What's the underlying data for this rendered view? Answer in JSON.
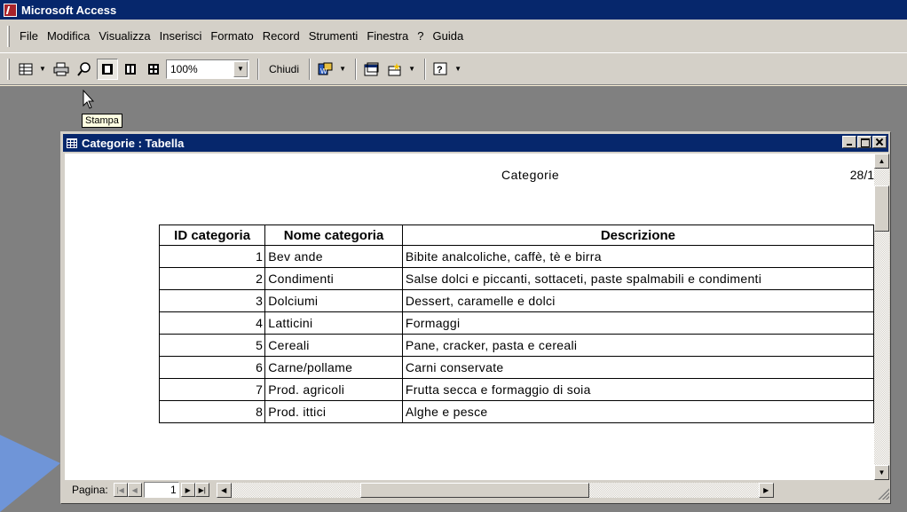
{
  "app": {
    "title": "Microsoft Access"
  },
  "menu": [
    "File",
    "Modifica",
    "Visualizza",
    "Inserisci",
    "Formato",
    "Record",
    "Strumenti",
    "Finestra",
    "?",
    "Guida"
  ],
  "toolbar": {
    "zoom_value": "100%",
    "close_label": "Chiudi",
    "tooltip": "Stampa",
    "icons": [
      "view-icon",
      "print-icon",
      "zoom-icon",
      "one-page-icon",
      "two-pages-icon",
      "multiple-pages-icon",
      "office-links-icon",
      "database-window-icon",
      "new-object-icon",
      "help-icon"
    ]
  },
  "document_window": {
    "title": "Categorie : Tabella",
    "report": {
      "header": "Categorie",
      "date": "28/1",
      "columns": [
        "ID categoria",
        "Nome categoria",
        "Descrizione"
      ],
      "rows": [
        [
          "1",
          "Bev ande",
          "Bibite analcoliche, caffè, tè e birra"
        ],
        [
          "2",
          "Condimenti",
          "Salse dolci e piccanti, sottaceti, paste spalmabili e condimenti"
        ],
        [
          "3",
          "Dolciumi",
          "Dessert, caramelle e dolci"
        ],
        [
          "4",
          "Latticini",
          "Formaggi"
        ],
        [
          "5",
          "Cereali",
          "Pane, cracker, pasta e cereali"
        ],
        [
          "6",
          "Carne/pollame",
          "Carni conservate"
        ],
        [
          "7",
          "Prod. agricoli",
          "Frutta secca e formaggio di soia"
        ],
        [
          "8",
          "Prod. ittici",
          "Alghe e pesce"
        ]
      ]
    },
    "status": {
      "page_label": "Pagina:",
      "page_value": "1"
    }
  },
  "colors": {
    "title_bar": "#06276c",
    "background": "#fbf0d6",
    "chrome": "#d4d0c8",
    "workspace": "#808080",
    "callout_arrow": "#6f95d8"
  }
}
